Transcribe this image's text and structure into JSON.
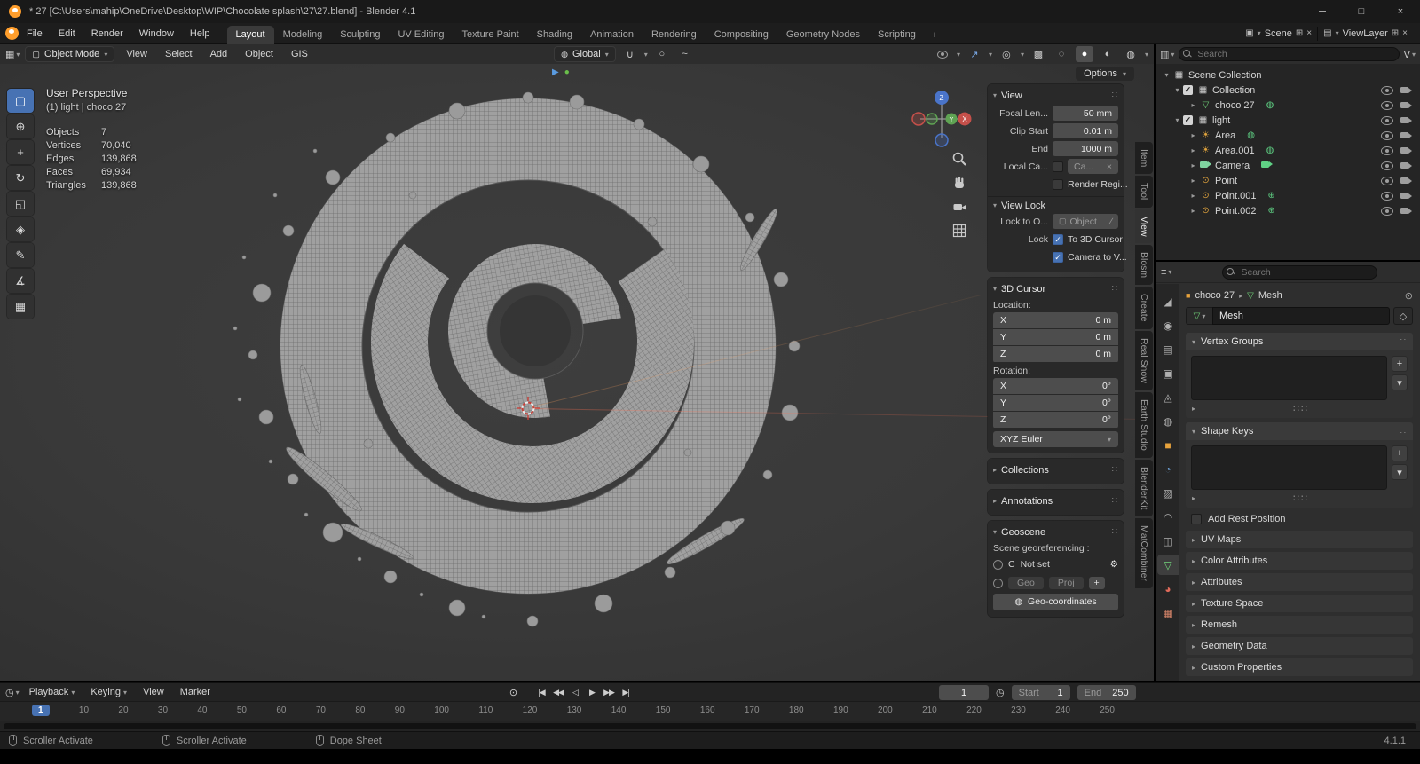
{
  "colors": {
    "accent_blue": "#4772b3",
    "object_orange": "#e8a33c",
    "data_green": "#71d47a",
    "light_orange": "#e0a33c"
  },
  "titlebar": {
    "title": "* 27 [C:\\Users\\mahip\\OneDrive\\Desktop\\WIP\\Chocolate splash\\27\\27.blend] - Blender 4.1"
  },
  "menubar": {
    "menus": [
      {
        "label": "File"
      },
      {
        "label": "Edit"
      },
      {
        "label": "Render"
      },
      {
        "label": "Window"
      },
      {
        "label": "Help"
      }
    ],
    "workspaces": [
      {
        "label": "Layout",
        "active": true
      },
      {
        "label": "Modeling"
      },
      {
        "label": "Sculpting"
      },
      {
        "label": "UV Editing"
      },
      {
        "label": "Texture Paint"
      },
      {
        "label": "Shading"
      },
      {
        "label": "Animation"
      },
      {
        "label": "Rendering"
      },
      {
        "label": "Compositing"
      },
      {
        "label": "Geometry Nodes"
      },
      {
        "label": "Scripting"
      }
    ],
    "add_tab": "+",
    "scene": "Scene",
    "viewlayer": "ViewLayer"
  },
  "header": {
    "mode": "Object Mode",
    "menus": [
      {
        "label": "View"
      },
      {
        "label": "Select"
      },
      {
        "label": "Add"
      },
      {
        "label": "Object"
      },
      {
        "label": "GIS"
      }
    ],
    "orientation": "Global",
    "options": "Options"
  },
  "viewport": {
    "perspective": "User Perspective",
    "context": "(1) light | choco 27",
    "stats": [
      {
        "label": "Objects",
        "value": "7"
      },
      {
        "label": "Vertices",
        "value": "70,040"
      },
      {
        "label": "Edges",
        "value": "139,868"
      },
      {
        "label": "Faces",
        "value": "69,934"
      },
      {
        "label": "Triangles",
        "value": "139,868"
      }
    ],
    "tools": [
      {
        "name": "select-box",
        "glyph": "▢",
        "active": true
      },
      {
        "name": "cursor",
        "glyph": "⊕"
      },
      {
        "name": "move",
        "glyph": "+"
      },
      {
        "name": "rotate",
        "glyph": "↻"
      },
      {
        "name": "scale",
        "glyph": "◱"
      },
      {
        "name": "transform",
        "glyph": "◈"
      },
      {
        "name": "annotate",
        "glyph": "✎"
      },
      {
        "name": "measure",
        "glyph": "∡"
      },
      {
        "name": "add-cube",
        "glyph": "▦"
      }
    ]
  },
  "npanel": {
    "tabs": [
      {
        "label": "Item"
      },
      {
        "label": "Tool"
      },
      {
        "label": "View",
        "active": true
      },
      {
        "label": "Blosm"
      },
      {
        "label": "Create"
      },
      {
        "label": "Real Snow"
      },
      {
        "label": "Earth Studio"
      },
      {
        "label": "BlenderKit"
      },
      {
        "label": "MatCombiner"
      }
    ],
    "view": {
      "title": "View",
      "focal_label": "Focal Len...",
      "focal_value": "50 mm",
      "clip_start_label": "Clip Start",
      "clip_start_value": "0.01 m",
      "clip_end_label": "End",
      "clip_end_value": "1000 m",
      "local_cam_label": "Local Ca...",
      "local_cam_value": "Ca...",
      "render_region_label": "Render Regi..."
    },
    "view_lock": {
      "title": "View Lock",
      "lock_to_label": "Lock to O...",
      "lock_to_value": "Object",
      "lock_label": "Lock",
      "to_3d_cursor": "To 3D Cursor",
      "camera_to_view": "Camera to V..."
    },
    "cursor": {
      "title": "3D Cursor",
      "location_label": "Location:",
      "location": [
        {
          "axis": "X",
          "value": "0 m"
        },
        {
          "axis": "Y",
          "value": "0 m"
        },
        {
          "axis": "Z",
          "value": "0 m"
        }
      ],
      "rotation_label": "Rotation:",
      "rotation": [
        {
          "axis": "X",
          "value": "0°"
        },
        {
          "axis": "Y",
          "value": "0°"
        },
        {
          "axis": "Z",
          "value": "0°"
        }
      ],
      "euler": "XYZ Euler"
    },
    "collections_title": "Collections",
    "annotations_title": "Annotations",
    "geoscene": {
      "title": "Geoscene",
      "georef_label": "Scene georeferencing :",
      "crs_letter": "C",
      "crs_value": "Not set",
      "geo_btn": "Geo",
      "proj_btn": "Proj",
      "add_btn": "+",
      "geocoords_btn": "Geo-coordinates"
    }
  },
  "outliner": {
    "search_placeholder": "Search",
    "rows": [
      {
        "label": "Scene Collection"
      },
      {
        "label": "Collection"
      },
      {
        "label": "choco 27"
      },
      {
        "label": "light"
      },
      {
        "label": "Area"
      },
      {
        "label": "Area.001"
      },
      {
        "label": "Camera"
      },
      {
        "label": "Point"
      },
      {
        "label": "Point.001"
      },
      {
        "label": "Point.002"
      }
    ]
  },
  "properties": {
    "search_placeholder": "Search",
    "tabs": [
      {
        "name": "tool",
        "glyph": "◢"
      },
      {
        "name": "render",
        "glyph": "◉"
      },
      {
        "name": "output",
        "glyph": "▤"
      },
      {
        "name": "view-layer",
        "glyph": "▣"
      },
      {
        "name": "scene",
        "glyph": "◬"
      },
      {
        "name": "world",
        "glyph": "◍"
      },
      {
        "name": "object",
        "glyph": "■"
      },
      {
        "name": "modifiers",
        "glyph": "◔"
      },
      {
        "name": "particles",
        "glyph": "▨"
      },
      {
        "name": "physics",
        "glyph": "◠"
      },
      {
        "name": "constraints",
        "glyph": "◫"
      },
      {
        "name": "object-data",
        "glyph": "▽",
        "active": true
      },
      {
        "name": "material",
        "glyph": "◕"
      },
      {
        "name": "texture",
        "glyph": "▦"
      }
    ],
    "breadcrumb_object": "choco 27",
    "breadcrumb_data": "Mesh",
    "name_value": "Mesh",
    "vertex_groups_title": "Vertex Groups",
    "shape_keys_title": "Shape Keys",
    "add_rest_position": "Add Rest Position",
    "collapsed": [
      {
        "label": "UV Maps"
      },
      {
        "label": "Color Attributes"
      },
      {
        "label": "Attributes"
      },
      {
        "label": "Texture Space"
      },
      {
        "label": "Remesh"
      },
      {
        "label": "Geometry Data"
      },
      {
        "label": "Custom Properties"
      }
    ]
  },
  "timeline": {
    "menus": [
      {
        "label": "Playback"
      },
      {
        "label": "Keying"
      },
      {
        "label": "View"
      },
      {
        "label": "Marker"
      }
    ],
    "playback": [
      {
        "name": "jump-to-start",
        "glyph": "|◀"
      },
      {
        "name": "prev-keyframe",
        "glyph": "◀◀"
      },
      {
        "name": "play-reverse",
        "glyph": "◁"
      },
      {
        "name": "play",
        "glyph": "▶"
      },
      {
        "name": "next-keyframe",
        "glyph": "▶▶"
      },
      {
        "name": "jump-to-end",
        "glyph": "▶|"
      }
    ],
    "frame_current": "1",
    "start_label": "Start",
    "start_value": "1",
    "end_label": "End",
    "end_value": "250",
    "ticks": [
      {
        "label": "1",
        "current": true
      },
      {
        "label": "10"
      },
      {
        "label": "20"
      },
      {
        "label": "30"
      },
      {
        "label": "40"
      },
      {
        "label": "50"
      },
      {
        "label": "60"
      },
      {
        "label": "70"
      },
      {
        "label": "80"
      },
      {
        "label": "90"
      },
      {
        "label": "100"
      },
      {
        "label": "110"
      },
      {
        "label": "120"
      },
      {
        "label": "130"
      },
      {
        "label": "140"
      },
      {
        "label": "150"
      },
      {
        "label": "160"
      },
      {
        "label": "170"
      },
      {
        "label": "180"
      },
      {
        "label": "190"
      },
      {
        "label": "200"
      },
      {
        "label": "210"
      },
      {
        "label": "220"
      },
      {
        "label": "230"
      },
      {
        "label": "240"
      },
      {
        "label": "250"
      }
    ]
  },
  "statusbar": {
    "items": [
      {
        "label": "Scroller Activate"
      },
      {
        "label": "Scroller Activate"
      },
      {
        "label": "Dope Sheet"
      }
    ],
    "version": "4.1.1"
  }
}
